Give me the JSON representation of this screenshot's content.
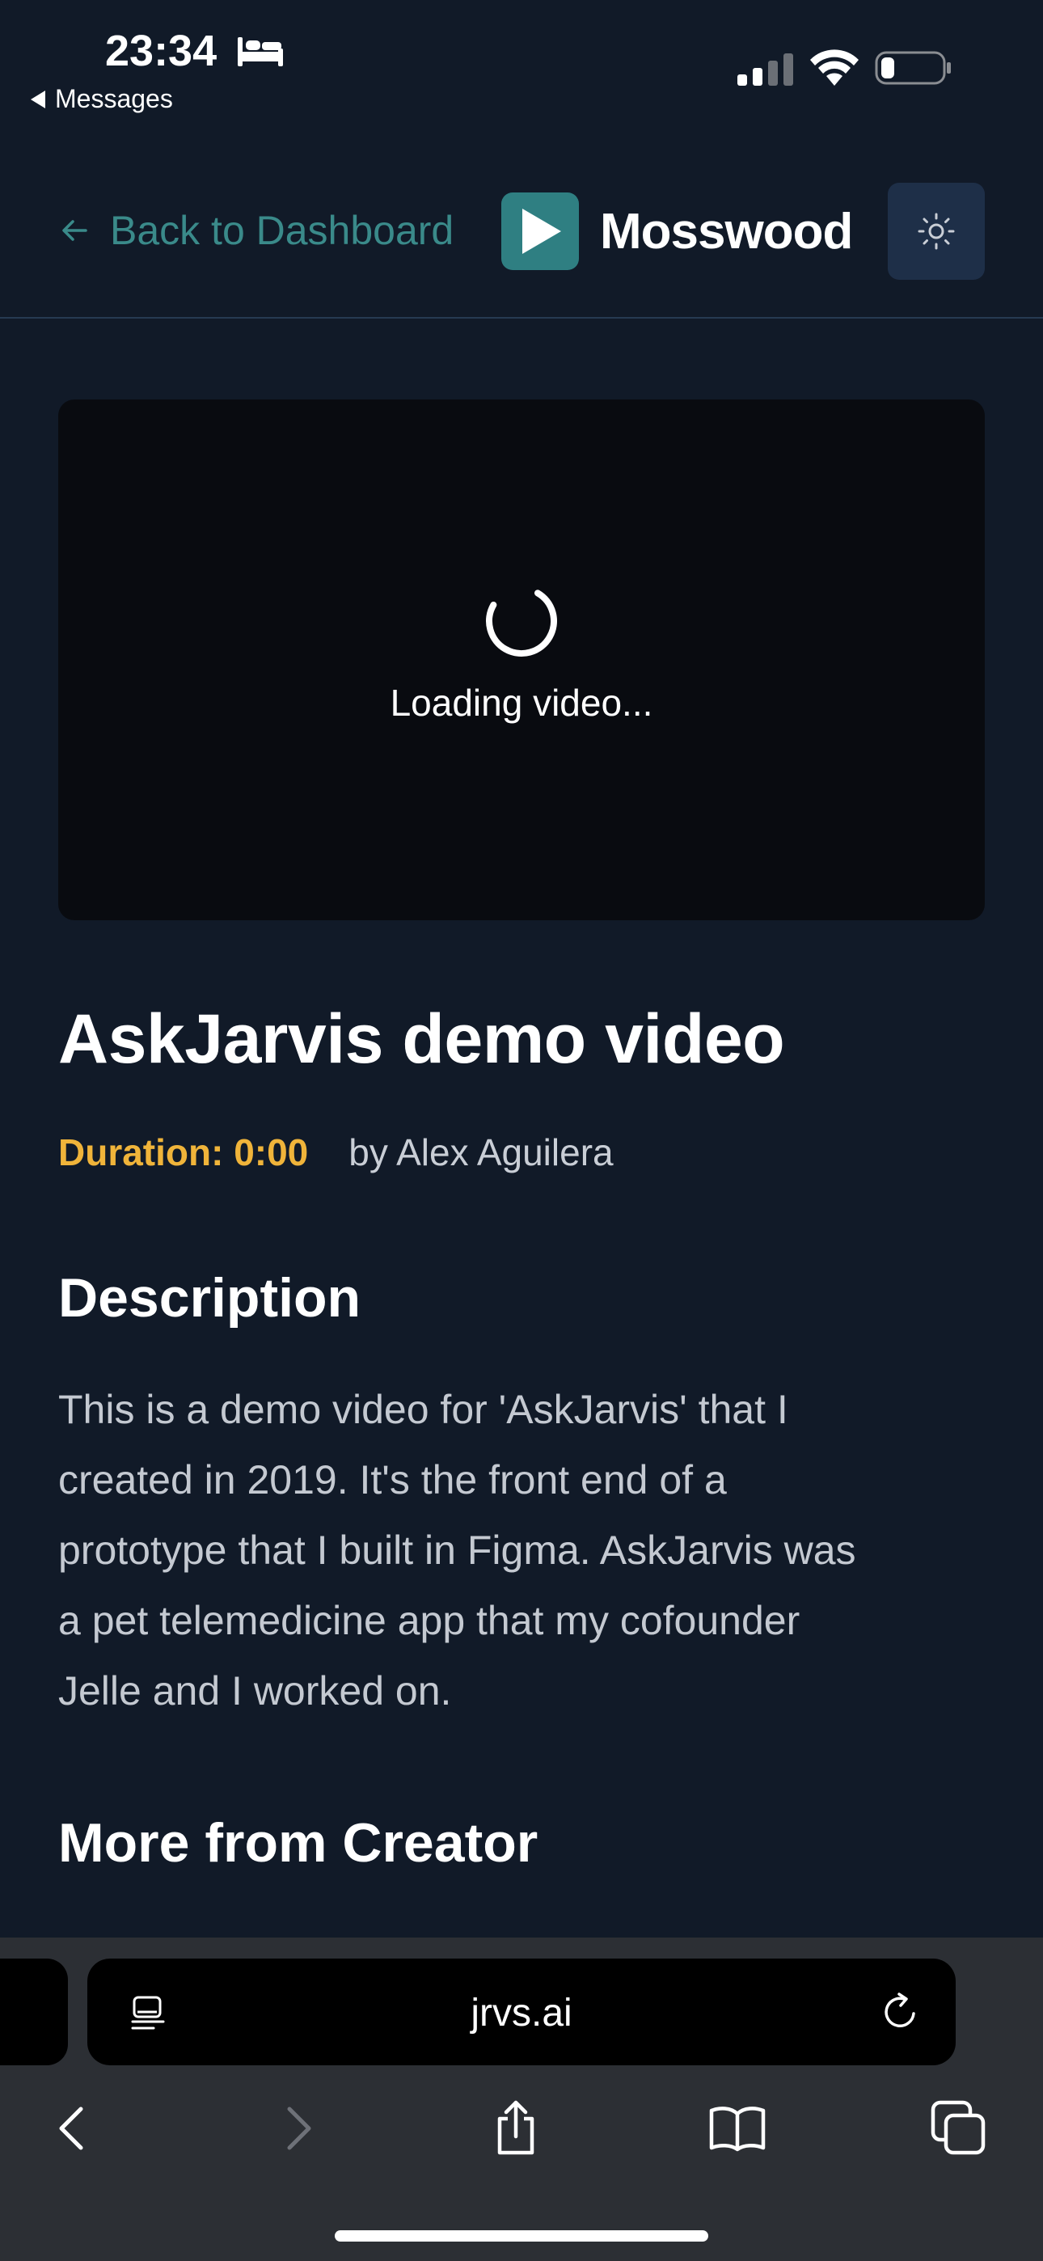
{
  "status_bar": {
    "time": "23:34",
    "back_app_label": "Messages"
  },
  "header": {
    "back_label": "Back to Dashboard",
    "brand_name": "Mosswood",
    "accent_color": "#3a8a8a"
  },
  "video": {
    "loading_text": "Loading video..."
  },
  "content": {
    "title": "AskJarvis demo video",
    "duration": "Duration: 0:00",
    "creator": "by Alex Aguilera",
    "description_heading": "Description",
    "description_lines": [
      "This is a demo video for 'AskJarvis' that I",
      "created in 2019. It's the front end of a",
      "prototype that I built in Figma. AskJarvis was",
      "a pet telemedicine app that my cofounder",
      "Jelle and I worked on."
    ],
    "more_heading": "More from Creator"
  },
  "browser": {
    "url": "jrvs.ai",
    "icons": [
      "page-menu-icon",
      "reload-icon",
      "back-icon",
      "forward-icon",
      "share-icon",
      "bookmarks-icon",
      "tabs-icon"
    ]
  }
}
